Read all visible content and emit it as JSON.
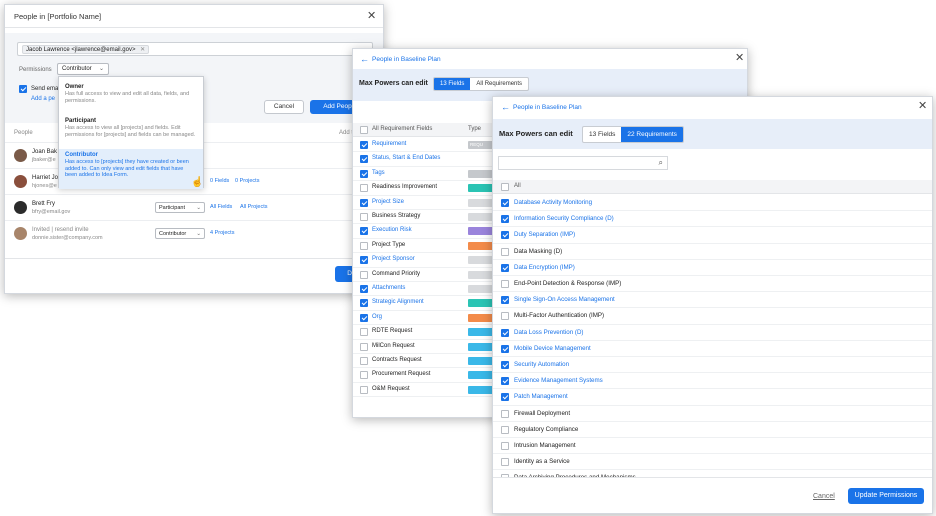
{
  "w1": {
    "title": "People in [Portfolio Name]",
    "chip": "Jacob Lawrence <jlawrence@email.gov>",
    "permissions_label": "Permissions",
    "permission_value": "Contributor",
    "send_email_label": "Send ema",
    "add_link": "Add a pe",
    "cancel_label": "Cancel",
    "add_people_label": "Add People",
    "col_people": "People",
    "col_add": "Add t",
    "done_label": "Done",
    "menu": [
      {
        "name": "Owner",
        "desc": "Has full access to view and edit all data, fields, and permissions."
      },
      {
        "name": "Participant",
        "desc": "Has access to view all [projects] and fields. Edit permissions for [projects] and fields can be managed."
      },
      {
        "name": "Contributor",
        "desc": "Has access to [projects] they have created or been added to. Can only view and edit fields that have been added to Idea Form."
      }
    ],
    "people": [
      {
        "name": "Joan Bak",
        "email": "jbaker@e",
        "role": "",
        "fields": "",
        "projects": ""
      },
      {
        "name": "Harriet Jo",
        "email": "hjones@e",
        "role": "",
        "fields": "0 Fields",
        "projects": "0 Projects"
      },
      {
        "name": "Brett Fry",
        "email": "bfry@email.gov",
        "role": "Participant",
        "fields": "All Fields",
        "projects": "All Projects"
      },
      {
        "name": "Invited | resend invite",
        "email": "donnie.sister@company.com",
        "role": "Contributor",
        "fields": "",
        "projects": "4 Projects"
      }
    ]
  },
  "w2": {
    "back_label": "People in Baseline Plan",
    "title": "Max Powers can edit",
    "tab_fields": "13 Fields",
    "tab_reqs": "All Requirements",
    "col_all": "All Requirement Fields",
    "col_type": "Type",
    "rows": [
      {
        "label": "Requirement",
        "checked": true,
        "tag": "REQU",
        "color": "#c5c8cc"
      },
      {
        "label": "Status, Start & End Dates",
        "checked": true,
        "tag": "",
        "color": ""
      },
      {
        "label": "Tags",
        "checked": true,
        "tag": "",
        "color": "#c5c8cc"
      },
      {
        "label": "Readiness Improvement",
        "checked": false,
        "tag": "",
        "color": "#2bc4b4"
      },
      {
        "label": "Project Size",
        "checked": true,
        "tag": "",
        "color": "#d8dadd"
      },
      {
        "label": "Business Strategy",
        "checked": false,
        "tag": "",
        "color": "#d8dadd"
      },
      {
        "label": "Execution Risk",
        "checked": true,
        "tag": "",
        "color": "#9a84dc"
      },
      {
        "label": "Project Type",
        "checked": false,
        "tag": "",
        "color": "#f38b4a"
      },
      {
        "label": "Project Sponsor",
        "checked": true,
        "tag": "",
        "color": "#d8dadd"
      },
      {
        "label": "Command Priority",
        "checked": false,
        "tag": "",
        "color": "#d8dadd"
      },
      {
        "label": "Attachments",
        "checked": true,
        "tag": "",
        "color": "#d8dadd"
      },
      {
        "label": "Strategic Alignment",
        "checked": true,
        "tag": "",
        "color": "#2bc4b4"
      },
      {
        "label": "Org",
        "checked": true,
        "tag": "",
        "color": "#f38b4a"
      },
      {
        "label": "RDTE Request",
        "checked": false,
        "tag": "",
        "color": "#3ab8e8"
      },
      {
        "label": "MilCon Request",
        "checked": false,
        "tag": "",
        "color": "#3ab8e8"
      },
      {
        "label": "Contracts Request",
        "checked": false,
        "tag": "",
        "color": "#3ab8e8"
      },
      {
        "label": "Procurement Request",
        "checked": false,
        "tag": "",
        "color": "#3ab8e8"
      },
      {
        "label": "O&M Request",
        "checked": false,
        "tag": "",
        "color": "#3ab8e8"
      }
    ]
  },
  "w3": {
    "back_label": "People in Baseline Plan",
    "title": "Max Powers can edit",
    "tab_fields": "13 Fields",
    "tab_reqs": "22 Requirements",
    "all_label": "All",
    "cancel_label": "Cancel",
    "update_label": "Update Permissions",
    "rows": [
      {
        "label": "Database Activity Monitoring",
        "checked": true
      },
      {
        "label": "Information Security Compliance (D)",
        "checked": true
      },
      {
        "label": "Duty Separation (IMP)",
        "checked": true
      },
      {
        "label": "Data Masking (D)",
        "checked": false
      },
      {
        "label": "Data Encryption (IMP)",
        "checked": true
      },
      {
        "label": "End-Point Detection & Response (IMP)",
        "checked": false
      },
      {
        "label": "Single Sign-On Access Management",
        "checked": true
      },
      {
        "label": "Multi-Factor Authentication (IMP)",
        "checked": false
      },
      {
        "label": "Data Loss Prevention (D)",
        "checked": true
      },
      {
        "label": "Mobile Device Management",
        "checked": true
      },
      {
        "label": "Security Automation",
        "checked": true
      },
      {
        "label": "Evidence Management Systems",
        "checked": true
      },
      {
        "label": "Patch Management",
        "checked": true
      },
      {
        "label": "Firewall Deployment",
        "checked": false
      },
      {
        "label": "Regulatory Compliance",
        "checked": false
      },
      {
        "label": "Intrusion Management",
        "checked": false
      },
      {
        "label": "Identity as a Service",
        "checked": false
      },
      {
        "label": "Data Archiving Procedures and Mechanisms",
        "checked": false
      }
    ]
  },
  "icons": {
    "close": "close-icon",
    "back": "arrow-left-icon",
    "search": "search-icon",
    "caret": "chevron-down-icon"
  },
  "colors": {
    "accent": "#1a73e8",
    "tint": "#e7eef9"
  }
}
